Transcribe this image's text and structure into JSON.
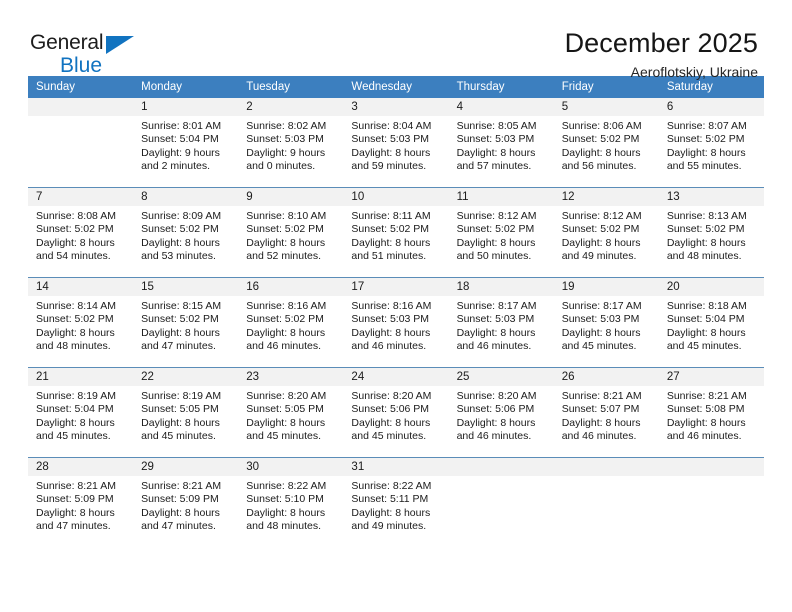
{
  "brand": {
    "name_top": "General",
    "name_bottom": "Blue",
    "triangle_icon": "triangle-icon",
    "color_blue": "#1173c0",
    "color_dark": "#1c1c1c"
  },
  "header": {
    "title": "December 2025",
    "subtitle": "Aeroflotskiy, Ukraine"
  },
  "theme": {
    "header_blue": "#3c7fbf",
    "daynum_bg": "#f2f2f2",
    "row_divider": "#5b8db8",
    "text": "#1b1b1b"
  },
  "calendar": {
    "weekday_headers": [
      "Sunday",
      "Monday",
      "Tuesday",
      "Wednesday",
      "Thursday",
      "Friday",
      "Saturday"
    ],
    "weeks": [
      [
        {
          "day": "",
          "sunrise": "",
          "sunset": "",
          "daylight": "",
          "empty": true
        },
        {
          "day": "1",
          "sunrise": "Sunrise: 8:01 AM",
          "sunset": "Sunset: 5:04 PM",
          "daylight": "Daylight: 9 hours and 2 minutes."
        },
        {
          "day": "2",
          "sunrise": "Sunrise: 8:02 AM",
          "sunset": "Sunset: 5:03 PM",
          "daylight": "Daylight: 9 hours and 0 minutes."
        },
        {
          "day": "3",
          "sunrise": "Sunrise: 8:04 AM",
          "sunset": "Sunset: 5:03 PM",
          "daylight": "Daylight: 8 hours and 59 minutes."
        },
        {
          "day": "4",
          "sunrise": "Sunrise: 8:05 AM",
          "sunset": "Sunset: 5:03 PM",
          "daylight": "Daylight: 8 hours and 57 minutes."
        },
        {
          "day": "5",
          "sunrise": "Sunrise: 8:06 AM",
          "sunset": "Sunset: 5:02 PM",
          "daylight": "Daylight: 8 hours and 56 minutes."
        },
        {
          "day": "6",
          "sunrise": "Sunrise: 8:07 AM",
          "sunset": "Sunset: 5:02 PM",
          "daylight": "Daylight: 8 hours and 55 minutes."
        }
      ],
      [
        {
          "day": "7",
          "sunrise": "Sunrise: 8:08 AM",
          "sunset": "Sunset: 5:02 PM",
          "daylight": "Daylight: 8 hours and 54 minutes."
        },
        {
          "day": "8",
          "sunrise": "Sunrise: 8:09 AM",
          "sunset": "Sunset: 5:02 PM",
          "daylight": "Daylight: 8 hours and 53 minutes."
        },
        {
          "day": "9",
          "sunrise": "Sunrise: 8:10 AM",
          "sunset": "Sunset: 5:02 PM",
          "daylight": "Daylight: 8 hours and 52 minutes."
        },
        {
          "day": "10",
          "sunrise": "Sunrise: 8:11 AM",
          "sunset": "Sunset: 5:02 PM",
          "daylight": "Daylight: 8 hours and 51 minutes."
        },
        {
          "day": "11",
          "sunrise": "Sunrise: 8:12 AM",
          "sunset": "Sunset: 5:02 PM",
          "daylight": "Daylight: 8 hours and 50 minutes."
        },
        {
          "day": "12",
          "sunrise": "Sunrise: 8:12 AM",
          "sunset": "Sunset: 5:02 PM",
          "daylight": "Daylight: 8 hours and 49 minutes."
        },
        {
          "day": "13",
          "sunrise": "Sunrise: 8:13 AM",
          "sunset": "Sunset: 5:02 PM",
          "daylight": "Daylight: 8 hours and 48 minutes."
        }
      ],
      [
        {
          "day": "14",
          "sunrise": "Sunrise: 8:14 AM",
          "sunset": "Sunset: 5:02 PM",
          "daylight": "Daylight: 8 hours and 48 minutes."
        },
        {
          "day": "15",
          "sunrise": "Sunrise: 8:15 AM",
          "sunset": "Sunset: 5:02 PM",
          "daylight": "Daylight: 8 hours and 47 minutes."
        },
        {
          "day": "16",
          "sunrise": "Sunrise: 8:16 AM",
          "sunset": "Sunset: 5:02 PM",
          "daylight": "Daylight: 8 hours and 46 minutes."
        },
        {
          "day": "17",
          "sunrise": "Sunrise: 8:16 AM",
          "sunset": "Sunset: 5:03 PM",
          "daylight": "Daylight: 8 hours and 46 minutes."
        },
        {
          "day": "18",
          "sunrise": "Sunrise: 8:17 AM",
          "sunset": "Sunset: 5:03 PM",
          "daylight": "Daylight: 8 hours and 46 minutes."
        },
        {
          "day": "19",
          "sunrise": "Sunrise: 8:17 AM",
          "sunset": "Sunset: 5:03 PM",
          "daylight": "Daylight: 8 hours and 45 minutes."
        },
        {
          "day": "20",
          "sunrise": "Sunrise: 8:18 AM",
          "sunset": "Sunset: 5:04 PM",
          "daylight": "Daylight: 8 hours and 45 minutes."
        }
      ],
      [
        {
          "day": "21",
          "sunrise": "Sunrise: 8:19 AM",
          "sunset": "Sunset: 5:04 PM",
          "daylight": "Daylight: 8 hours and 45 minutes."
        },
        {
          "day": "22",
          "sunrise": "Sunrise: 8:19 AM",
          "sunset": "Sunset: 5:05 PM",
          "daylight": "Daylight: 8 hours and 45 minutes."
        },
        {
          "day": "23",
          "sunrise": "Sunrise: 8:20 AM",
          "sunset": "Sunset: 5:05 PM",
          "daylight": "Daylight: 8 hours and 45 minutes."
        },
        {
          "day": "24",
          "sunrise": "Sunrise: 8:20 AM",
          "sunset": "Sunset: 5:06 PM",
          "daylight": "Daylight: 8 hours and 45 minutes."
        },
        {
          "day": "25",
          "sunrise": "Sunrise: 8:20 AM",
          "sunset": "Sunset: 5:06 PM",
          "daylight": "Daylight: 8 hours and 46 minutes."
        },
        {
          "day": "26",
          "sunrise": "Sunrise: 8:21 AM",
          "sunset": "Sunset: 5:07 PM",
          "daylight": "Daylight: 8 hours and 46 minutes."
        },
        {
          "day": "27",
          "sunrise": "Sunrise: 8:21 AM",
          "sunset": "Sunset: 5:08 PM",
          "daylight": "Daylight: 8 hours and 46 minutes."
        }
      ],
      [
        {
          "day": "28",
          "sunrise": "Sunrise: 8:21 AM",
          "sunset": "Sunset: 5:09 PM",
          "daylight": "Daylight: 8 hours and 47 minutes."
        },
        {
          "day": "29",
          "sunrise": "Sunrise: 8:21 AM",
          "sunset": "Sunset: 5:09 PM",
          "daylight": "Daylight: 8 hours and 47 minutes."
        },
        {
          "day": "30",
          "sunrise": "Sunrise: 8:22 AM",
          "sunset": "Sunset: 5:10 PM",
          "daylight": "Daylight: 8 hours and 48 minutes."
        },
        {
          "day": "31",
          "sunrise": "Sunrise: 8:22 AM",
          "sunset": "Sunset: 5:11 PM",
          "daylight": "Daylight: 8 hours and 49 minutes."
        },
        {
          "day": "",
          "sunrise": "",
          "sunset": "",
          "daylight": "",
          "empty": true
        },
        {
          "day": "",
          "sunrise": "",
          "sunset": "",
          "daylight": "",
          "empty": true
        },
        {
          "day": "",
          "sunrise": "",
          "sunset": "",
          "daylight": "",
          "empty": true
        }
      ]
    ]
  }
}
